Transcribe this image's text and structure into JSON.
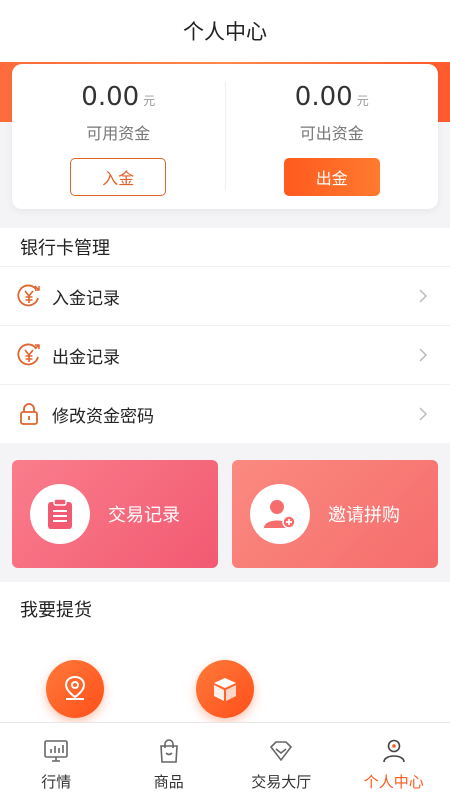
{
  "header": {
    "title": "个人中心"
  },
  "balance": {
    "available": {
      "amount": "0.00",
      "unit": "元",
      "label": "可用资金",
      "button": "入金"
    },
    "withdrawable": {
      "amount": "0.00",
      "unit": "元",
      "label": "可出资金",
      "button": "出金"
    }
  },
  "bank_section": {
    "title": "银行卡管理",
    "items": [
      {
        "label": "入金记录",
        "icon": "yuan-in-icon"
      },
      {
        "label": "出金记录",
        "icon": "yuan-out-icon"
      },
      {
        "label": "修改资金密码",
        "icon": "lock-icon"
      }
    ]
  },
  "promos": [
    {
      "label": "交易记录",
      "icon": "clipboard-icon"
    },
    {
      "label": "邀请拼购",
      "icon": "add-user-icon"
    }
  ],
  "pickup": {
    "title": "我要提货",
    "icons": [
      "location-pin-icon",
      "box-icon"
    ]
  },
  "tabbar": {
    "items": [
      {
        "label": "行情",
        "icon": "monitor-chart-icon",
        "active": false
      },
      {
        "label": "商品",
        "icon": "shopping-bag-icon",
        "active": false
      },
      {
        "label": "交易大厅",
        "icon": "diamond-icon",
        "active": false
      },
      {
        "label": "个人中心",
        "icon": "user-icon",
        "active": true
      }
    ]
  },
  "colors": {
    "accent": "#ff5a1f",
    "promo_left": "#f25a72",
    "promo_right": "#f56d6d"
  }
}
